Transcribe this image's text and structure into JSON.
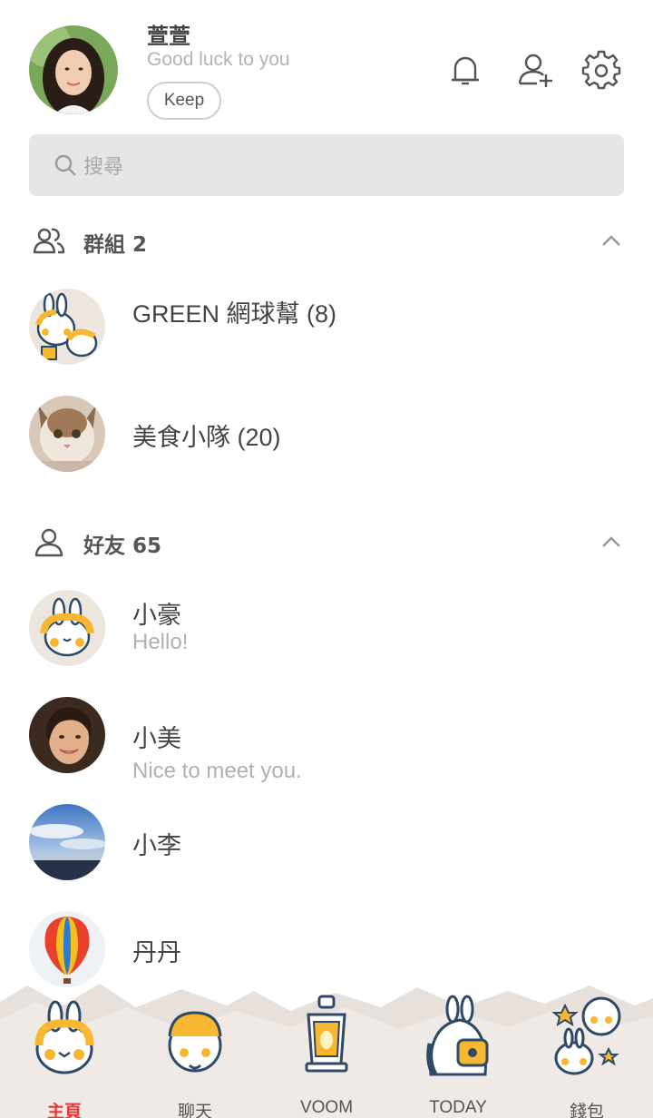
{
  "profile": {
    "name": "萱萱",
    "status_message": "Good luck to you",
    "keep_label": "Keep"
  },
  "header_icons": [
    "bell-icon",
    "add-friend-icon",
    "settings-gear-icon"
  ],
  "search": {
    "placeholder": "搜尋"
  },
  "groups_section": {
    "title": "群組 2",
    "items": [
      {
        "name": "GREEN 網球幫 (8)"
      },
      {
        "name": "美食小隊 (20)"
      }
    ]
  },
  "friends_section": {
    "title": "好友 65",
    "items": [
      {
        "name": "小豪",
        "status": "Hello!"
      },
      {
        "name": "小美",
        "status": "Nice to meet you."
      },
      {
        "name": "小李",
        "status": ""
      },
      {
        "name": "丹丹",
        "status": ""
      }
    ]
  },
  "tabs": [
    {
      "label": "主頁",
      "active": true
    },
    {
      "label": "聊天",
      "active": false
    },
    {
      "label": "VOOM",
      "active": false
    },
    {
      "label": "TODAY",
      "active": false
    },
    {
      "label": "錢包",
      "active": false
    }
  ],
  "colors": {
    "active_tab": "#e03a3a",
    "search_bg": "#e6e6e6",
    "tabbar_mountains": "#e7e0db",
    "accent_yellow": "#f7b731",
    "sticker_outline": "#2f4a67"
  }
}
